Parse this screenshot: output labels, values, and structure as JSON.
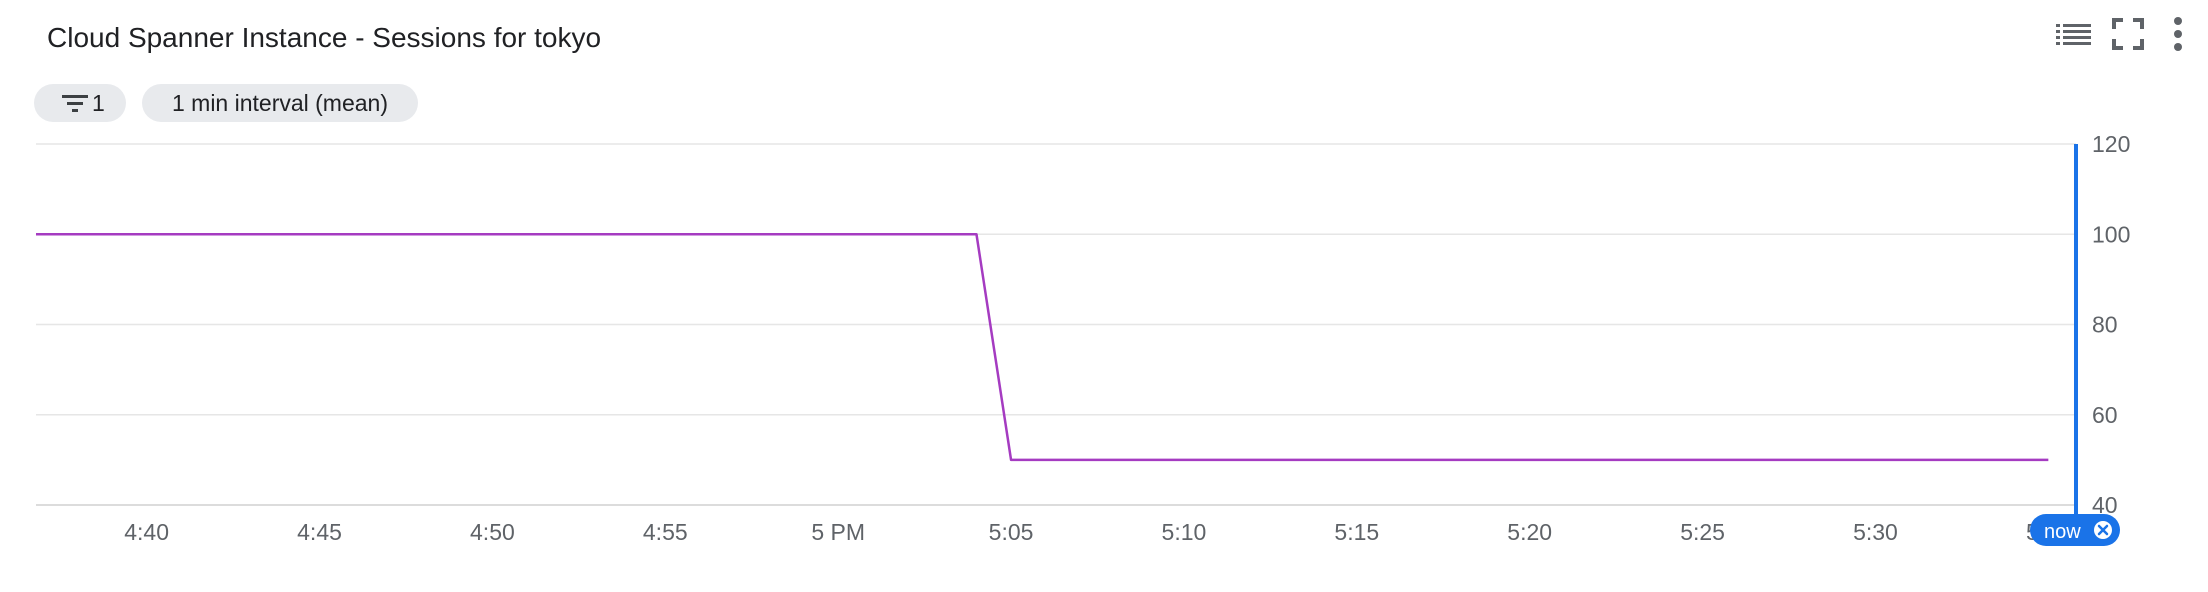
{
  "title": "Cloud Spanner Instance - Sessions for tokyo",
  "toolbar": {
    "legend_icon": "legend-list-icon",
    "fullscreen_icon": "fullscreen-icon",
    "more_icon": "more-vert-icon"
  },
  "chips": {
    "filter_count": "1",
    "interval": "1 min interval (mean)"
  },
  "colors": {
    "series": "#a53bc1",
    "now_marker": "#1a73e8",
    "grid": "#e6e6e6",
    "axis_text": "#5f6368"
  },
  "chart_data": {
    "type": "line",
    "title": "Cloud Spanner Instance - Sessions for tokyo",
    "xlabel": "",
    "ylabel": "",
    "x_ticks": [
      "4:40",
      "4:45",
      "4:50",
      "4:55",
      "5 PM",
      "5:05",
      "5:10",
      "5:15",
      "5:20",
      "5:25",
      "5:30",
      "5:35"
    ],
    "y_ticks": [
      40,
      60,
      80,
      100,
      120
    ],
    "ylim": [
      40,
      120
    ],
    "xlim_minutes_after_4pm": [
      36.8,
      95.8
    ],
    "y_axis_side": "right",
    "grid": true,
    "now_marker_label": "now",
    "series": [
      {
        "x_minutes_after_4pm": [
          36.8,
          64,
          65,
          95
        ],
        "values": [
          100,
          100,
          50,
          50
        ]
      }
    ]
  }
}
